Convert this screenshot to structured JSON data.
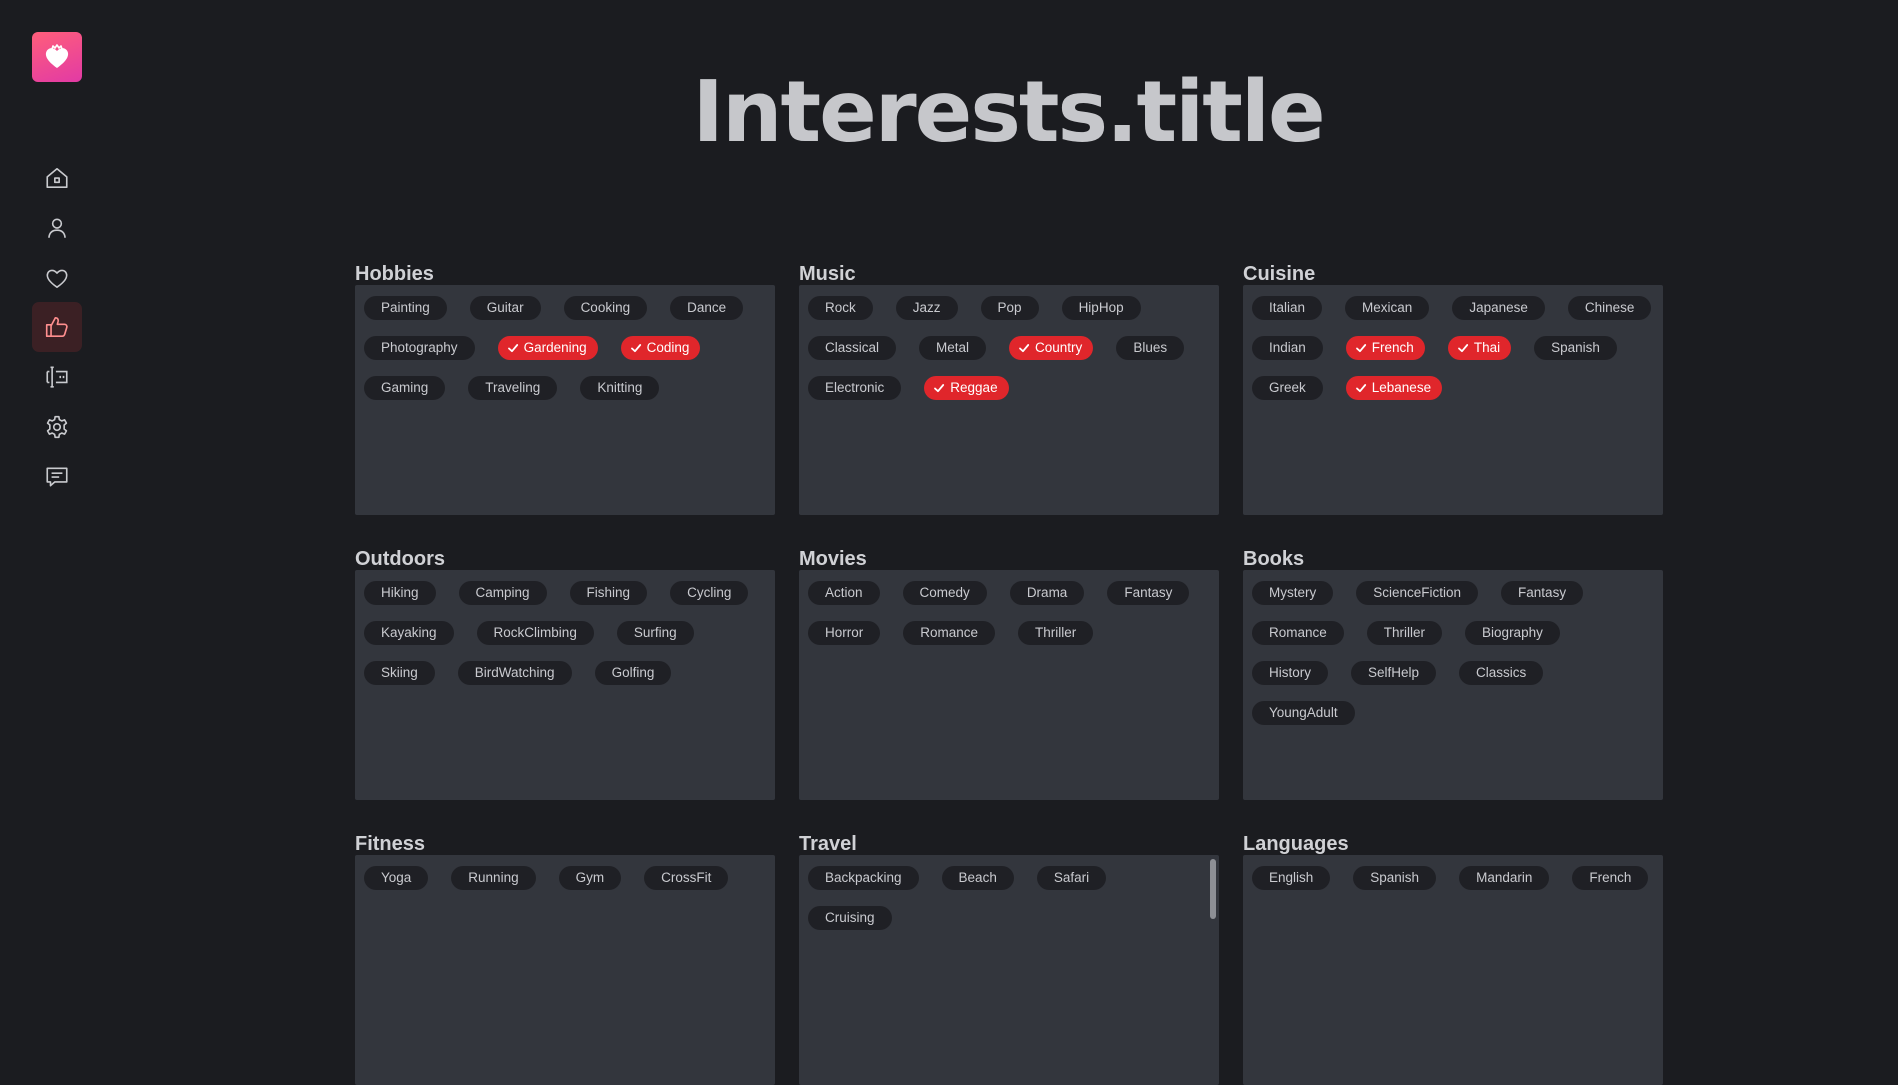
{
  "page": {
    "title": "Interests.title"
  },
  "colors": {
    "accent": "#e0262b",
    "logo_from": "#ff5e7a",
    "logo_to": "#e23aa5",
    "background": "#1b1c20",
    "panel": "#33363d"
  },
  "sidebar": {
    "items": [
      {
        "name": "home",
        "icon": "home-icon"
      },
      {
        "name": "profile",
        "icon": "user-icon"
      },
      {
        "name": "matches",
        "icon": "heart-icon"
      },
      {
        "name": "interests",
        "icon": "thumbs-up-icon",
        "active": true
      },
      {
        "name": "editor",
        "icon": "text-cursor-icon"
      },
      {
        "name": "settings",
        "icon": "gear-icon"
      },
      {
        "name": "messages",
        "icon": "chat-icon"
      }
    ]
  },
  "sections": [
    {
      "title": "Hobbies",
      "chips": [
        {
          "label": "Painting"
        },
        {
          "label": "Guitar"
        },
        {
          "label": "Cooking"
        },
        {
          "label": "Dance"
        },
        {
          "label": "Photography"
        },
        {
          "label": "Gardening",
          "selected": true
        },
        {
          "label": "Coding",
          "selected": true
        },
        {
          "label": "Gaming"
        },
        {
          "label": "Traveling"
        },
        {
          "label": "Knitting"
        }
      ]
    },
    {
      "title": "Music",
      "chips": [
        {
          "label": "Rock"
        },
        {
          "label": "Jazz"
        },
        {
          "label": "Pop"
        },
        {
          "label": "HipHop"
        },
        {
          "label": "Classical"
        },
        {
          "label": "Metal"
        },
        {
          "label": "Country",
          "selected": true
        },
        {
          "label": "Blues"
        },
        {
          "label": "Electronic"
        },
        {
          "label": "Reggae",
          "selected": true
        }
      ]
    },
    {
      "title": "Cuisine",
      "chips": [
        {
          "label": "Italian"
        },
        {
          "label": "Mexican"
        },
        {
          "label": "Japanese"
        },
        {
          "label": "Chinese"
        },
        {
          "label": "Indian"
        },
        {
          "label": "French",
          "selected": true
        },
        {
          "label": "Thai",
          "selected": true
        },
        {
          "label": "Spanish"
        },
        {
          "label": "Greek"
        },
        {
          "label": "Lebanese",
          "selected": true
        }
      ]
    },
    {
      "title": "Outdoors",
      "chips": [
        {
          "label": "Hiking"
        },
        {
          "label": "Camping"
        },
        {
          "label": "Fishing"
        },
        {
          "label": "Cycling"
        },
        {
          "label": "Kayaking"
        },
        {
          "label": "RockClimbing"
        },
        {
          "label": "Surfing"
        },
        {
          "label": "Skiing"
        },
        {
          "label": "BirdWatching"
        },
        {
          "label": "Golfing"
        }
      ]
    },
    {
      "title": "Movies",
      "chips": [
        {
          "label": "Action"
        },
        {
          "label": "Comedy"
        },
        {
          "label": "Drama"
        },
        {
          "label": "Fantasy"
        },
        {
          "label": "Horror"
        },
        {
          "label": "Romance"
        },
        {
          "label": "Thriller"
        }
      ]
    },
    {
      "title": "Books",
      "chips": [
        {
          "label": "Mystery"
        },
        {
          "label": "ScienceFiction"
        },
        {
          "label": "Fantasy"
        },
        {
          "label": "Romance"
        },
        {
          "label": "Thriller"
        },
        {
          "label": "Biography"
        },
        {
          "label": "History"
        },
        {
          "label": "SelfHelp"
        },
        {
          "label": "Classics"
        },
        {
          "label": "YoungAdult"
        }
      ]
    },
    {
      "title": "Fitness",
      "chips": [
        {
          "label": "Yoga"
        },
        {
          "label": "Running"
        },
        {
          "label": "Gym"
        },
        {
          "label": "CrossFit"
        }
      ]
    },
    {
      "title": "Travel",
      "scrollable": true,
      "chips": [
        {
          "label": "Backpacking"
        },
        {
          "label": "Beach"
        },
        {
          "label": "Safari"
        },
        {
          "label": "Cruising"
        }
      ]
    },
    {
      "title": "Languages",
      "chips": [
        {
          "label": "English"
        },
        {
          "label": "Spanish"
        },
        {
          "label": "Mandarin"
        },
        {
          "label": "French"
        }
      ]
    }
  ]
}
